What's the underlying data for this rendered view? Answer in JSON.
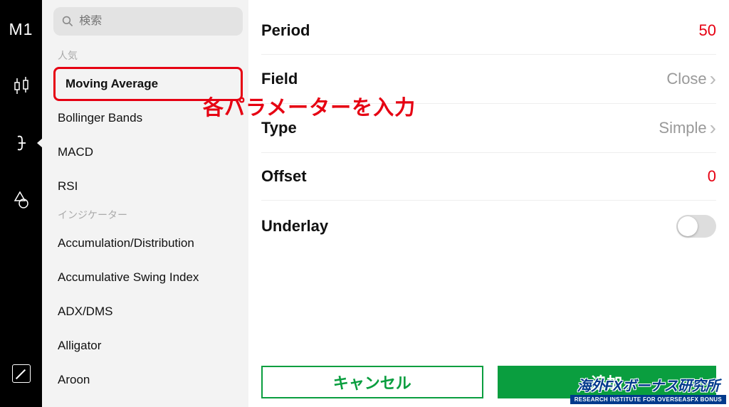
{
  "toolbar": {
    "timeframe": "M1"
  },
  "search": {
    "placeholder": "検索"
  },
  "sidebar": {
    "section_popular": "人気",
    "section_indicators": "インジケーター",
    "popular": [
      "Moving Average",
      "Bollinger Bands",
      "MACD",
      "RSI"
    ],
    "indicators": [
      "Accumulation/Distribution",
      "Accumulative Swing Index",
      "ADX/DMS",
      "Alligator",
      "Aroon"
    ]
  },
  "params": {
    "period_label": "Period",
    "period_value": "50",
    "field_label": "Field",
    "field_value": "Close",
    "type_label": "Type",
    "type_value": "Simple",
    "offset_label": "Offset",
    "offset_value": "0",
    "underlay_label": "Underlay"
  },
  "buttons": {
    "cancel": "キャンセル",
    "add": "追加"
  },
  "annotation": "各パラメーターを入力",
  "watermark": {
    "title": "海外FXボーナス研究所",
    "subtitle": "RESEARCH INSTITUTE FOR OVERSEASFX BONUS"
  }
}
